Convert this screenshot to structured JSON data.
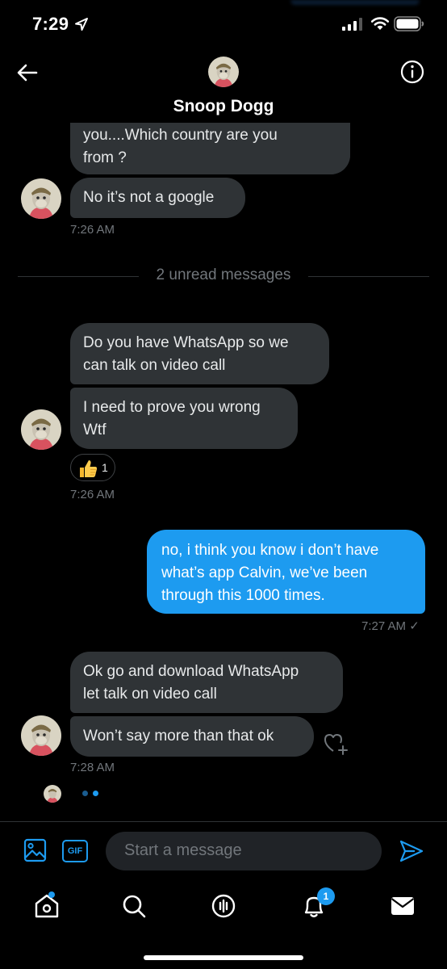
{
  "status_bar": {
    "time": "7:29"
  },
  "header": {
    "title": "Snoop Dogg"
  },
  "messages": {
    "m1": {
      "line1": "you....Which country are you",
      "line2": "from ?"
    },
    "m2": {
      "text": "No it’s not a google"
    },
    "ts1": "7:26 AM",
    "divider": "2 unread messages",
    "m3": {
      "line1": "Do you have WhatsApp so we",
      "line2": "can talk on video call"
    },
    "m4": {
      "line1": "I need to prove you wrong",
      "line2": "Wtf"
    },
    "reaction": {
      "emoji": "thumbs-up",
      "count": "1"
    },
    "ts2": "7:26 AM",
    "m5": {
      "line1": "no, i think you know i don’t have",
      "line2": "what’s app Calvin, we’ve been",
      "line3": "through this 1000 times."
    },
    "ts3": "7:27 AM ✓",
    "m6": {
      "line1": "Ok go and download WhatsApp",
      "line2": "let talk on video call"
    },
    "m7": {
      "text": "Won’t say more than that ok"
    },
    "ts4": "7:28 AM"
  },
  "composer": {
    "gif_label": "GIF",
    "placeholder": "Start a message"
  },
  "nav": {
    "notifications_badge": "1",
    "items": [
      "home",
      "search",
      "spaces",
      "notifications",
      "messages"
    ]
  },
  "colors": {
    "accent": "#1d9bf0",
    "incoming_bubble": "#2f3336",
    "background": "#000000",
    "muted_text": "#71767b"
  }
}
